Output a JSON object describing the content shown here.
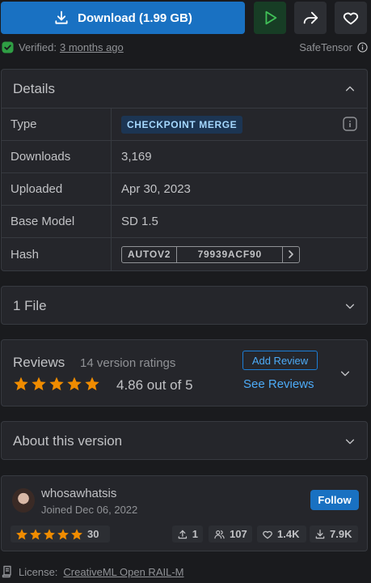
{
  "actions": {
    "download_label": "Download (1.99 GB)"
  },
  "verified": {
    "label": "Verified:",
    "when": "3 months ago",
    "format": "SafeTensor"
  },
  "details": {
    "title": "Details",
    "rows": {
      "type_label": "Type",
      "type_value": "CHECKPOINT MERGE",
      "downloads_label": "Downloads",
      "downloads_value": "3,169",
      "uploaded_label": "Uploaded",
      "uploaded_value": "Apr 30, 2023",
      "base_model_label": "Base Model",
      "base_model_value": "SD 1.5",
      "hash_label": "Hash",
      "hash_type": "AUTOV2",
      "hash_value": "79939ACF90"
    }
  },
  "files": {
    "title": "1 File"
  },
  "reviews": {
    "title": "Reviews",
    "count_text": "14 version ratings",
    "score_text": "4.86 out of 5",
    "rating": 4.86,
    "add_label": "Add Review",
    "see_label": "See Reviews"
  },
  "about": {
    "title": "About this version"
  },
  "creator": {
    "name": "whosawhatsis",
    "joined": "Joined Dec 06, 2022",
    "follow_label": "Follow",
    "rating_count": "30",
    "uploads": "1",
    "followers": "107",
    "likes": "1.4K",
    "downloads": "7.9K"
  },
  "license": {
    "label": "License:",
    "name": "CreativeML Open RAIL-M"
  },
  "colors": {
    "star": "#f08c00",
    "accent": "#1971c2",
    "play": "#40c057"
  }
}
